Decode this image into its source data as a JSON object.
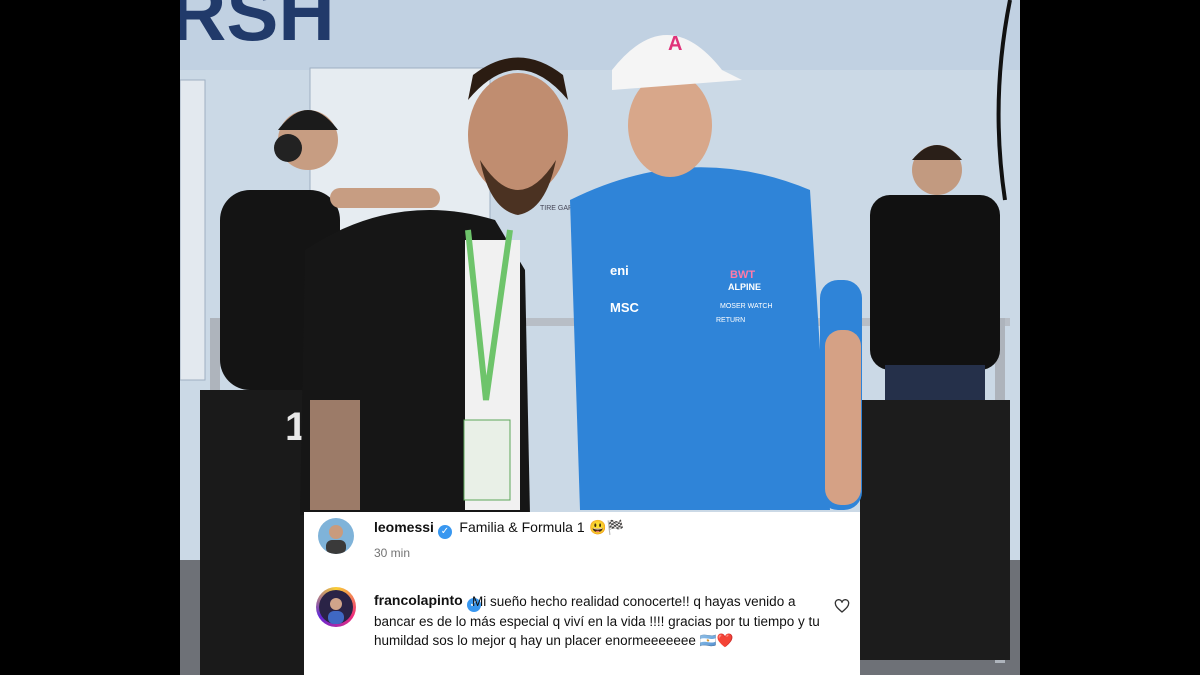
{
  "post": {
    "username": "leomessi",
    "caption": "Familia & Formula 1",
    "caption_emoji": "😃🏁",
    "time": "30 min"
  },
  "comment": {
    "username": "francolapinto",
    "text": "Mi sueño hecho realidad conocerte!! q hayas venido a bancar es de lo más especial q viví en la vida !!!! gracias por tu tiempo y tu humildad sos lo mejor q hay un placer enormeeeeeee 🇦🇷❤️"
  },
  "photo_text": {
    "sign_fragment": "RSH",
    "pole_number": "1",
    "door_sign": "TIRE GARAGE"
  },
  "shirt_logos": {
    "brand_a": "ALPINE",
    "brand_b": "BWT",
    "brand_c": "MSC",
    "brand_d": "eni",
    "brand_e": "MOSER WATCH",
    "brand_f": "RETURN"
  },
  "colors": {
    "panel_bg": "#ffffff",
    "verified_blue": "#3897f0",
    "alpine_blue": "#2f84d8",
    "heart_red": "#e0245e"
  }
}
